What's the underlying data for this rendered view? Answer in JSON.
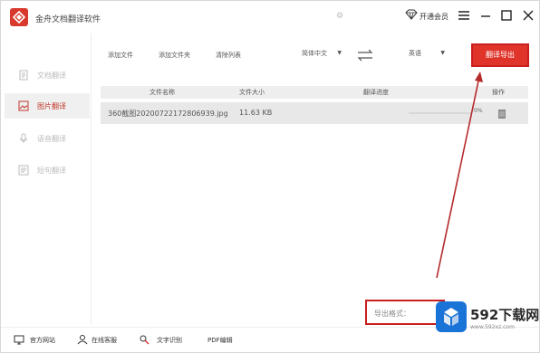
{
  "app": {
    "title": "金舟文档翻译软件",
    "vip_label": "开通会员"
  },
  "sidebar": {
    "items": [
      {
        "label": "文档翻译",
        "active": false
      },
      {
        "label": "图片翻译",
        "active": true
      },
      {
        "label": "语音翻译",
        "active": false
      },
      {
        "label": "短句翻译",
        "active": false
      }
    ]
  },
  "toolbar": {
    "add_file": "添加文件",
    "add_folder": "添加文件夹",
    "clear_list": "清除列表",
    "source_lang": "简体中文",
    "target_lang": "英语",
    "export_button": "翻译导出"
  },
  "table": {
    "headers": [
      "文件名称",
      "文件大小",
      "翻译进度",
      "操作"
    ],
    "rows": [
      {
        "name": "360截图20200722172806939.jpg",
        "size": "11.63 KB",
        "progress": "0%"
      }
    ]
  },
  "footer": {
    "website": "官方网站",
    "support": "在线客服",
    "text_recognition": "文字识别",
    "pdf_edit": "PDF编辑"
  },
  "export_format": {
    "label": "导出格式："
  },
  "watermark": {
    "text": "592下载网",
    "sub": "www.592xz.com"
  },
  "colors": {
    "accent": "#e0342a",
    "annotation": "#c91f1f"
  }
}
